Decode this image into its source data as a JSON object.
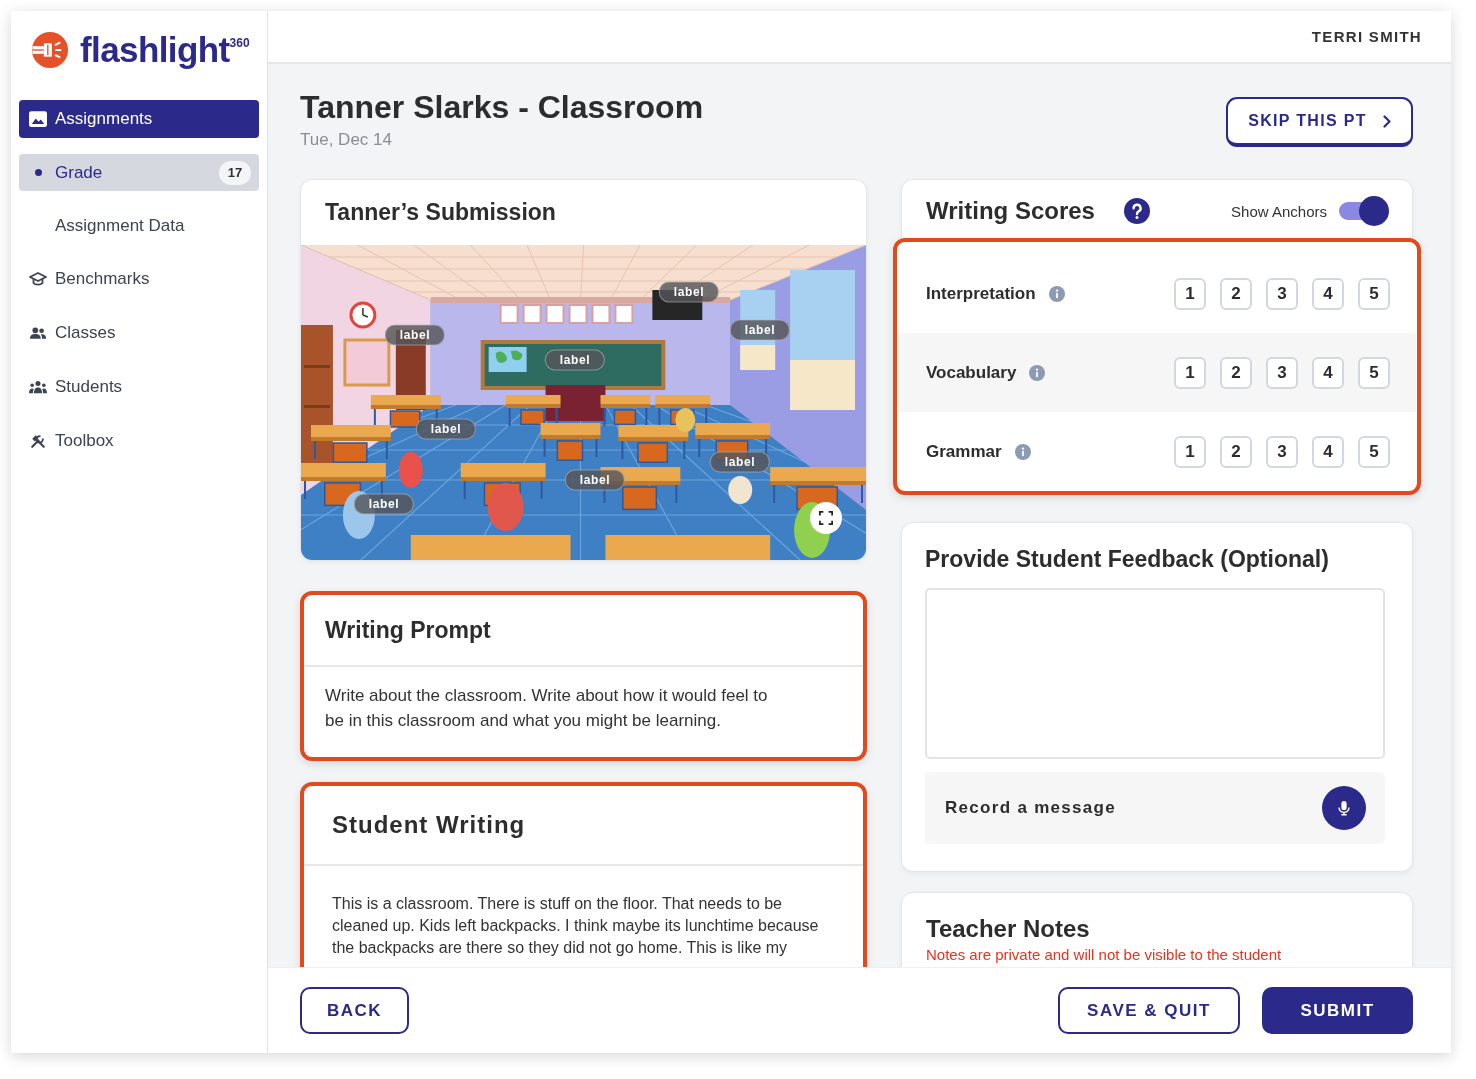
{
  "sidebar": {
    "logo": "flashlight$^{360}$",
    "items": [
      {
        "label": "Assignments",
        "selected": true,
        "children": [
          {
            "label": "Grade",
            "selected": true,
            "badge": "17"
          },
          {
            "label": "Assignment Data",
            "selected": false
          }
        ]
      },
      {
        "label": "Benchmarks",
        "selected": false
      },
      {
        "label": "Classes",
        "selected": false
      },
      {
        "label": "Students",
        "selected": false
      },
      {
        "label": "Toolbox",
        "selected": false
      }
    ]
  },
  "header": {
    "user": "TERRI SMITH"
  },
  "page": {
    "title": "Tanner Slarks - Classroom",
    "date": "Tue, Dec 14",
    "skip_button": "SKIP THIS PT"
  },
  "submission": {
    "title": "Tanner’s Submission",
    "image_labels": [
      "label",
      "label",
      "label",
      "label",
      "label",
      "label",
      "label",
      "label"
    ]
  },
  "writing_prompt": {
    "title": "Writing Prompt",
    "text": "Write about the classroom. Write about how it would feel to be in this classroom and what you might be learning.",
    "highlighted": true
  },
  "student_writing": {
    "title": "Student Writing",
    "text": "This is a classroom. There is stuff on the floor. That needs to be cleaned up. Kids left backpacks. I think maybe its lunchtime because the backpacks are there so they did not go home. This is like my",
    "highlighted": true
  },
  "writing_scores": {
    "title": "Writing Scores",
    "show_anchors": {
      "label": "Show Anchors",
      "on": true
    },
    "highlighted": true,
    "criteria": [
      {
        "name": "Interpretation",
        "scores": [
          {
            "label": "1",
            "selected": false
          },
          {
            "label": "2",
            "selected": false
          },
          {
            "label": "3",
            "selected": false
          },
          {
            "label": "4",
            "selected": false
          },
          {
            "label": "5",
            "selected": false
          }
        ]
      },
      {
        "name": "Vocabulary",
        "scores": [
          {
            "label": "1",
            "selected": false
          },
          {
            "label": "2",
            "selected": false
          },
          {
            "label": "3",
            "selected": false
          },
          {
            "label": "4",
            "selected": false
          },
          {
            "label": "5",
            "selected": false
          }
        ]
      },
      {
        "name": "Grammar",
        "scores": [
          {
            "label": "1",
            "selected": false
          },
          {
            "label": "2",
            "selected": false
          },
          {
            "label": "3",
            "selected": false
          },
          {
            "label": "4",
            "selected": false
          },
          {
            "label": "5",
            "selected": false
          }
        ]
      }
    ]
  },
  "feedback": {
    "title": "Provide Student Feedback (Optional)",
    "record_label": "Record a message"
  },
  "teacher_notes": {
    "title": "Teacher Notes",
    "note": "Notes are private and will not be visible to the student"
  },
  "footer": {
    "back": "BACK",
    "save": "SAVE & QUIT",
    "submit": "SUBMIT"
  }
}
